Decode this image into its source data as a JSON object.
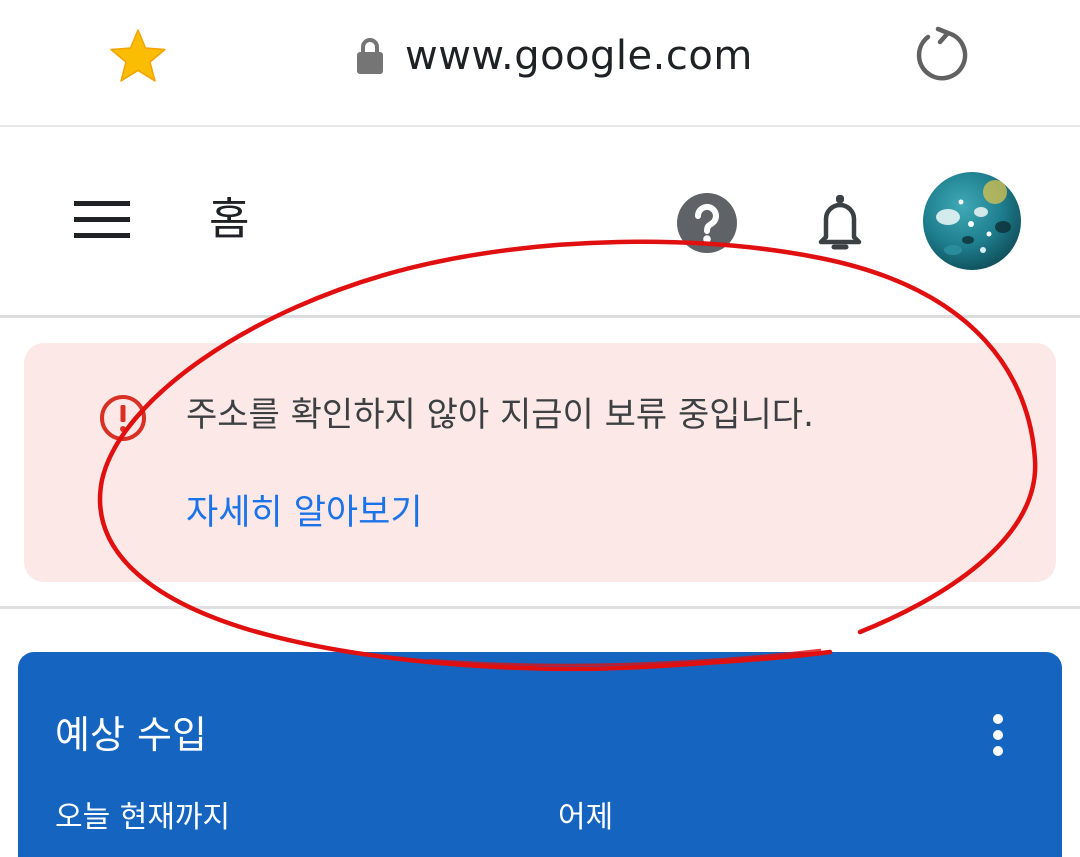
{
  "browser": {
    "url": "www.google.com",
    "icons": [
      "star-icon",
      "lock-icon",
      "reload-icon"
    ],
    "star_color": "#fbbc04"
  },
  "header": {
    "title": "홈",
    "icons": [
      "menu-icon",
      "help-icon",
      "bell-icon",
      "avatar"
    ]
  },
  "alert": {
    "message": "주소를 확인하지 않아 지금이 보류 중입니다.",
    "link": "자세히 알아보기",
    "icon": "error-icon",
    "background": "#fce8e6",
    "icon_color": "#d93025",
    "link_color": "#1a73e8"
  },
  "earnings_card": {
    "title": "예상 수입",
    "today_label": "오늘 현재까지",
    "yesterday_label": "어제",
    "background": "#1565c0",
    "icon": "more-vert-icon"
  },
  "annotation": {
    "shape": "hand-drawn ellipse",
    "color": "#e01010"
  }
}
